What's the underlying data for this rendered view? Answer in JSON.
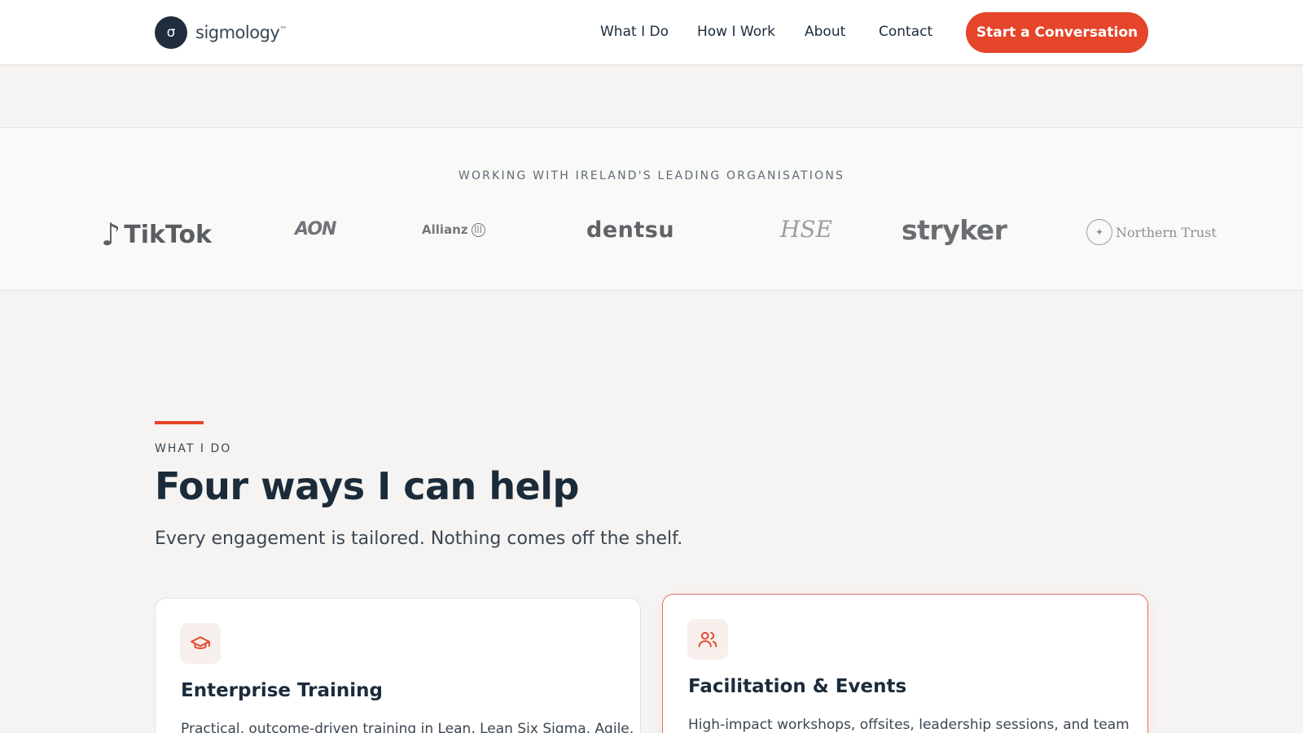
{
  "header": {
    "logo": {
      "mark": "σ",
      "text": "sigmology",
      "tm": "™"
    },
    "nav": [
      {
        "label": "What I Do"
      },
      {
        "label": "How I Work"
      },
      {
        "label": "About"
      },
      {
        "label": "Contact"
      }
    ],
    "cta_label": "Start a Conversation"
  },
  "clients": {
    "heading": "WORKING WITH IRELAND'S LEADING ORGANISATIONS",
    "logos": [
      {
        "name": "TikTok"
      },
      {
        "name": "AON"
      },
      {
        "name": "Allianz"
      },
      {
        "name": "dentsu"
      },
      {
        "name": "HSE"
      },
      {
        "name": "stryker"
      },
      {
        "name": "Northern Trust"
      }
    ]
  },
  "section": {
    "eyebrow": "WHAT I DO",
    "title": "Four ways I can help",
    "subtitle": "Every engagement is tailored. Nothing comes off the shelf.",
    "cards": [
      {
        "icon": "graduation-cap-icon",
        "title": "Enterprise Training",
        "description": "Practical, outcome-driven training in Lean, Lean Six Sigma, Agile,"
      },
      {
        "icon": "users-icon",
        "title": "Facilitation & Events",
        "description": "High-impact workshops, offsites, leadership sessions, and team"
      }
    ]
  },
  "colors": {
    "accent": "#e5452a",
    "navy": "#1c2b3a",
    "background": "#f5f4f2"
  }
}
